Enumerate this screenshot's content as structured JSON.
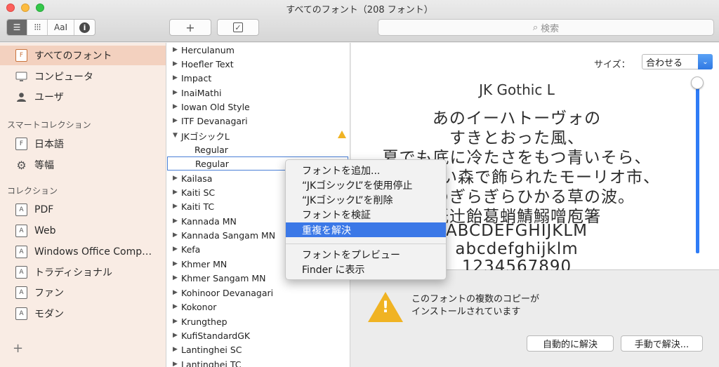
{
  "window": {
    "title": "すべてのフォント（208 フォント）"
  },
  "toolbar": {
    "view_aa_label": "AaI",
    "add_label": "+",
    "check_label": "✓",
    "search_placeholder": "検索"
  },
  "sidebar": {
    "library_items": [
      {
        "label": "すべてのフォント",
        "icon": "F"
      },
      {
        "label": "コンピュータ"
      },
      {
        "label": "ユーザ"
      }
    ],
    "smart_header": "スマートコレクション",
    "smart_items": [
      {
        "label": "日本語",
        "icon": "F"
      },
      {
        "label": "等幅"
      }
    ],
    "collection_header": "コレクション",
    "collection_items": [
      {
        "label": "PDF",
        "icon": "A"
      },
      {
        "label": "Web",
        "icon": "A"
      },
      {
        "label": "Windows Office Comp…",
        "icon": "A"
      },
      {
        "label": "トラディショナル",
        "icon": "A"
      },
      {
        "label": "ファン",
        "icon": "A"
      },
      {
        "label": "モダン",
        "icon": "A"
      }
    ],
    "add_label": "+"
  },
  "fontlist": {
    "rows": [
      {
        "label": "Herculanum",
        "tri": "▶"
      },
      {
        "label": "Hoefler Text",
        "tri": "▶"
      },
      {
        "label": "Impact",
        "tri": "▶"
      },
      {
        "label": "InaiMathi",
        "tri": "▶"
      },
      {
        "label": "Iowan Old Style",
        "tri": "▶"
      },
      {
        "label": "ITF Devanagari",
        "tri": "▶"
      },
      {
        "label": "JKゴシックL",
        "tri": "▼"
      },
      {
        "label": "Regular",
        "tri": ""
      },
      {
        "label": "Regular",
        "tri": ""
      },
      {
        "label": "Kailasa",
        "tri": "▶"
      },
      {
        "label": "Kaiti SC",
        "tri": "▶"
      },
      {
        "label": "Kaiti TC",
        "tri": "▶"
      },
      {
        "label": "Kannada MN",
        "tri": "▶"
      },
      {
        "label": "Kannada Sangam MN",
        "tri": "▶"
      },
      {
        "label": "Kefa",
        "tri": "▶"
      },
      {
        "label": "Khmer MN",
        "tri": "▶"
      },
      {
        "label": "Khmer Sangam MN",
        "tri": "▶"
      },
      {
        "label": "Kohinoor Devanagari",
        "tri": "▶"
      },
      {
        "label": "Kokonor",
        "tri": "▶"
      },
      {
        "label": "Krungthep",
        "tri": "▶"
      },
      {
        "label": "KufiStandardGK",
        "tri": "▶"
      },
      {
        "label": "Lantinghei SC",
        "tri": "▶"
      },
      {
        "label": "Lantinghei TC",
        "tri": "▶"
      }
    ]
  },
  "preview": {
    "size_label": "サイズ：",
    "size_value": "合わせる",
    "font_name": "JK Gothic L",
    "lines": [
      "あのイーハトーヴォの",
      "すきとおった風、",
      "夏でも底に冷たさをもつ青いそら、",
      "うつくしい森で飾られたモーリオ市、",
      "郊外のぎらぎらひかる草の波。",
      "祇辻飴葛蛸鯖鰯噌庖箸",
      "ABCDEFGHIJKLM",
      "abcdefghijklm",
      "1234567890"
    ]
  },
  "info": {
    "message_line1": "このフォントの複数のコピーが",
    "message_line2": "インストールされています",
    "auto_resolve": "自動的に解決",
    "manual_resolve": "手動で解決..."
  },
  "context_menu": {
    "items": [
      "フォントを追加...",
      "“JKゴシックL”を使用停止",
      "“JKゴシックL”を削除",
      "フォントを検証",
      "重複を解決",
      "フォントをプレビュー",
      "Finder に表示"
    ],
    "highlighted_index": 4
  },
  "colors": {
    "sidebar_bg": "#f9ece4",
    "sidebar_selected": "#f3d1bf",
    "menu_highlight": "#3b78e7",
    "warning": "#f0b323",
    "slider": "#2f7cf6"
  }
}
